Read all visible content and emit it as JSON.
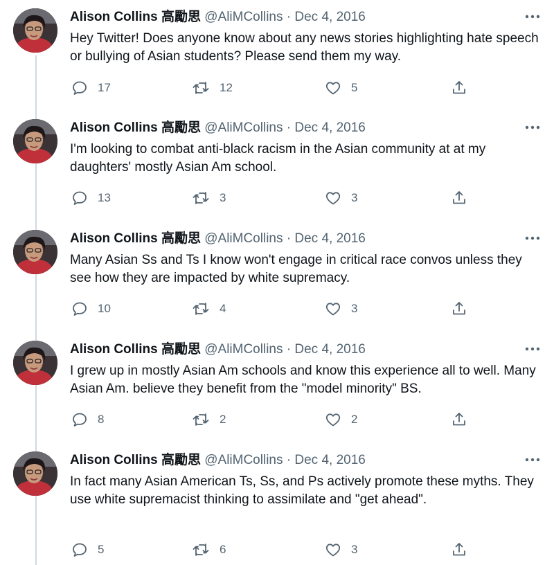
{
  "author": {
    "name": "Alison Collins 高勵思",
    "handle": "@AliMCollins",
    "separator": "·"
  },
  "icons": {
    "reply": "reply-icon",
    "retweet": "retweet-icon",
    "like": "heart-icon",
    "share": "share-icon",
    "more": "more-icon"
  },
  "colors": {
    "text": "#0f1419",
    "secondary": "#536471",
    "thread_line": "#cfd9de"
  },
  "tweets": [
    {
      "date": "Dec 4, 2016",
      "text": "Hey Twitter! Does anyone know about any news stories highlighting hate speech or bullying of Asian students? Please send them my way.",
      "replies": "17",
      "retweets": "12",
      "likes": "5"
    },
    {
      "date": "Dec 4, 2016",
      "text": "I'm looking to combat anti-black racism in the Asian community at at my daughters' mostly Asian Am school.",
      "replies": "13",
      "retweets": "3",
      "likes": "3"
    },
    {
      "date": "Dec 4, 2016",
      "text": "Many Asian Ss and Ts I know won't engage in critical race convos unless they see how they are impacted by white supremacy.",
      "replies": "10",
      "retweets": "4",
      "likes": "3"
    },
    {
      "date": "Dec 4, 2016",
      "text": "I grew up in mostly Asian Am schools and know this experience all to well. Many Asian Am. believe they benefit from the \"model minority\" BS.",
      "replies": "8",
      "retweets": "2",
      "likes": "2"
    },
    {
      "date": "Dec 4, 2016",
      "text": "In fact many Asian American Ts, Ss, and Ps actively promote these myths. They use white supremacist thinking to assimilate and \"get ahead\".",
      "replies": "5",
      "retweets": "6",
      "likes": "3"
    }
  ]
}
